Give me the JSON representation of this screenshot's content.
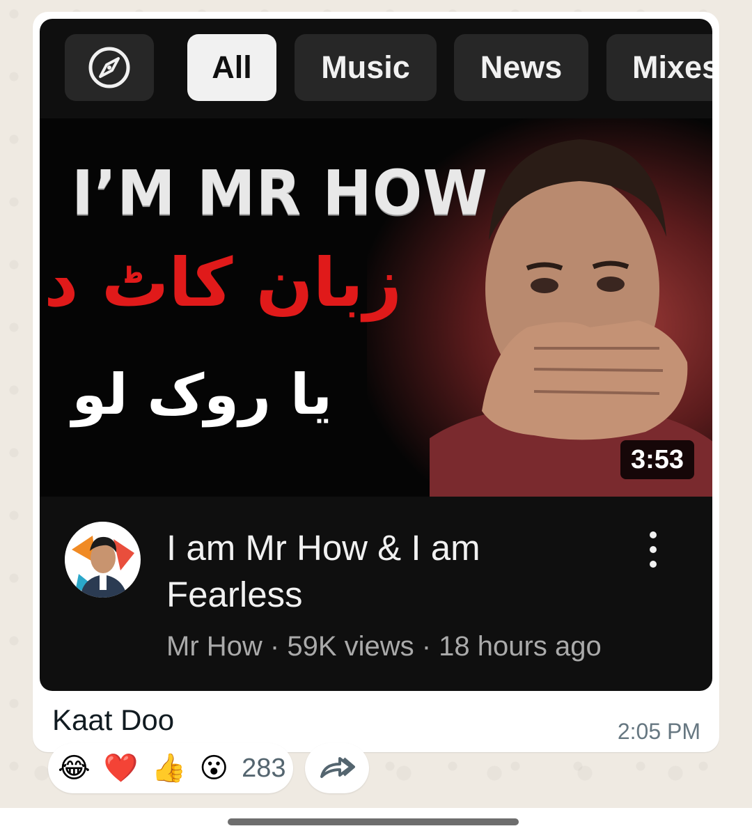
{
  "chips": [
    {
      "label": "All",
      "active": true
    },
    {
      "label": "Music",
      "active": false
    },
    {
      "label": "News",
      "active": false
    },
    {
      "label": "Mixes",
      "active": false
    }
  ],
  "explore_icon": "compass-icon",
  "thumbnail": {
    "title_text": "I’M  MR HOW",
    "urdu_line_1": "زبان کاٹ دو",
    "urdu_line_2": "یا روک لو",
    "duration": "3:53"
  },
  "video": {
    "title": "I am Mr How & I am Fearless",
    "channel": "Mr How",
    "views": "59K views",
    "age": "18 hours ago",
    "meta": "Mr How · 59K views · 18 hours ago",
    "more_icon": "more-vertical-icon"
  },
  "message": {
    "caption": "Kaat Doo",
    "time": "2:05 PM"
  },
  "reactions": {
    "emojis": [
      "😂",
      "❤️",
      "👍",
      "😮"
    ],
    "count": "283"
  },
  "forward_icon": "forward-icon",
  "colors": {
    "chat_background": "#efeae2",
    "preview_background": "#0f0f0f",
    "chip_background": "#272727",
    "chip_active_background": "#f1f1f1",
    "urdu_red": "#e01a1a"
  }
}
